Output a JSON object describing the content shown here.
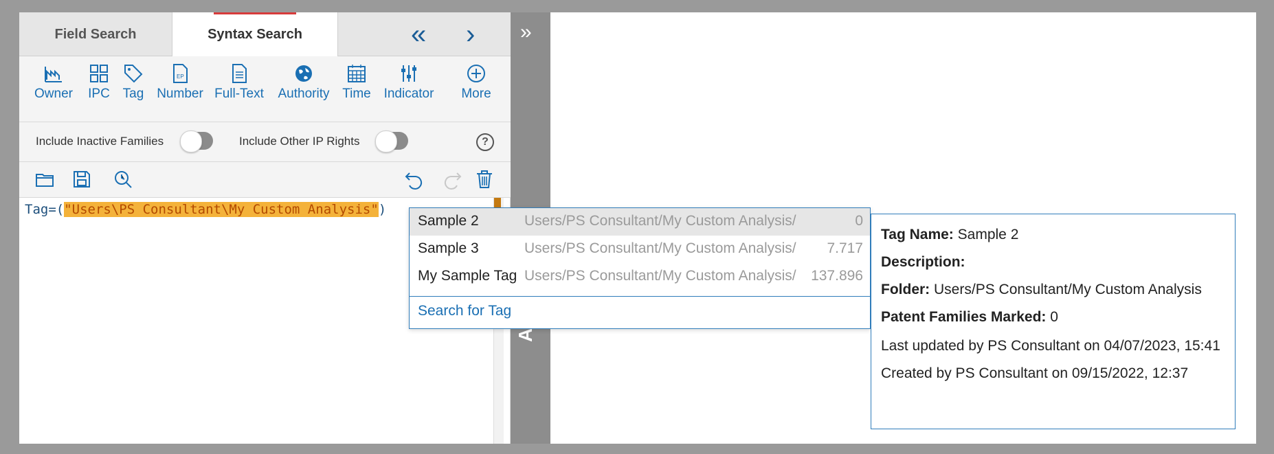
{
  "tabs": {
    "field_search": "Field Search",
    "syntax_search": "Syntax Search"
  },
  "toolbar": [
    {
      "label": "Owner",
      "icon": "factory-icon"
    },
    {
      "label": "IPC",
      "icon": "grid-icon"
    },
    {
      "label": "Tag",
      "icon": "tag-icon"
    },
    {
      "label": "Number",
      "icon": "document-ep-icon"
    },
    {
      "label": "Full-Text",
      "icon": "document-text-icon"
    },
    {
      "label": "Authority",
      "icon": "globe-icon"
    },
    {
      "label": "Time",
      "icon": "calendar-icon"
    },
    {
      "label": "Indicator",
      "icon": "sliders-icon"
    },
    {
      "label": "More",
      "icon": "plus-circle-icon"
    }
  ],
  "options": {
    "include_inactive": "Include Inactive Families",
    "include_other_ip": "Include Other IP Rights",
    "help": "?"
  },
  "editor": {
    "prefix": "Tag=(",
    "string": "\"Users\\PS Consultant\\My Custom Analysis\"",
    "suffix": ")"
  },
  "analysis_label": "Analysis",
  "dropdown": {
    "items": [
      {
        "name": "Sample 2",
        "path": "Users/PS Consultant/My Custom Analysis/",
        "count": "0"
      },
      {
        "name": "Sample 3",
        "path": "Users/PS Consultant/My Custom Analysis/",
        "count": "7.717"
      },
      {
        "name": "My Sample Tag",
        "path": "Users/PS Consultant/My Custom Analysis/",
        "count": "137.896"
      }
    ],
    "search_link": "Search for Tag"
  },
  "info": {
    "tag_name_label": "Tag Name:",
    "tag_name": "Sample 2",
    "description_label": "Description:",
    "folder_label": "Folder:",
    "folder": "Users/PS Consultant/My Custom Analysis",
    "families_label": "Patent Families Marked:",
    "families": "0",
    "last_updated": "Last updated by PS Consultant on 04/07/2023, 15:41",
    "created": "Created by PS Consultant on 09/15/2022, 12:37"
  },
  "colors": {
    "accent": "#1a6fb3",
    "highlight": "#f4b23a",
    "active_tab_marker": "#d73b3b"
  }
}
